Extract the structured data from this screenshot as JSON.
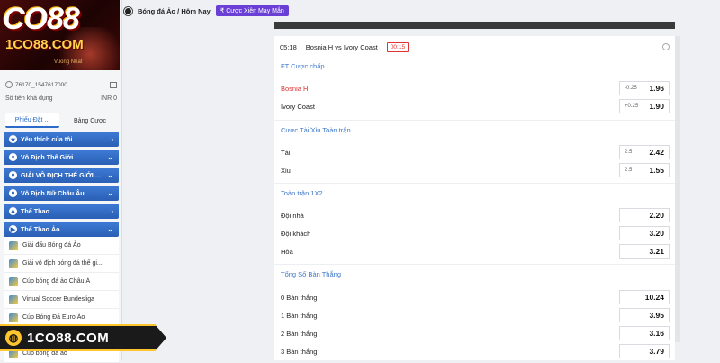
{
  "logo": {
    "brand": "CO88",
    "domain": "1CO88.COM",
    "sub": "Vuong Nhat"
  },
  "account": {
    "id": "76170_1547617000...",
    "balance_label": "Số tiền khả dụng",
    "balance_value": "INR 0"
  },
  "tabs": [
    {
      "label": "Phiếu Đặt ..."
    },
    {
      "label": "Bảng Cược"
    }
  ],
  "menu": [
    {
      "label": "Yêu thích của tôi",
      "icon": "star-icon",
      "chev": "›"
    },
    {
      "label": "Vô Địch Thế Giới",
      "icon": "trophy-icon",
      "chev": "⌄"
    },
    {
      "label": "GIẢI VÔ ĐỊCH THẾ GIỚI ...",
      "icon": "football-icon",
      "chev": "⌄"
    },
    {
      "label": "Vô Địch Nữ Châu Âu",
      "icon": "football-icon",
      "chev": "⌄"
    },
    {
      "label": "Thể Thao",
      "icon": "sports-icon",
      "chev": "›"
    },
    {
      "label": "Thể Thao Ảo",
      "icon": "virtual-sports-icon",
      "chev": "⌄"
    }
  ],
  "submenu": [
    "Giải đấu Bóng đá Ảo",
    "Giải vô địch bóng đá thế gi...",
    "Cúp bóng đá ảo Châu Á",
    "Virtual Soccer Bundesliga",
    "Cúp Bóng Đá Euro Ảo",
    "",
    "Cúp bóng đá ảo"
  ],
  "banner": {
    "text": "1CO88.COM"
  },
  "topbar": {
    "path": "Bóng đá Ảo / Hôm Nay",
    "pill": "₹ Cược Xiên May Mắn"
  },
  "match": {
    "time": "05:18",
    "teams": "Bosnia H vs Ivory Coast",
    "timer": "00:15"
  },
  "sections": {
    "ft": "FT Cược chấp",
    "ou": "Cược Tài/Xỉu Toàn trận",
    "x12": "Toàn trận 1X2",
    "goals": "Tổng Số Bàn Thắng"
  },
  "ft_rows": [
    {
      "name": "Bosnia H",
      "hc": "-0.25",
      "odd": "1.96"
    },
    {
      "name": "Ivory Coast",
      "hc": "+0.25",
      "odd": "1.90"
    }
  ],
  "ou_rows": [
    {
      "name": "Tài",
      "hc": "2.5",
      "odd": "2.42"
    },
    {
      "name": "Xỉu",
      "hc": "2.5",
      "odd": "1.55"
    }
  ],
  "x12_rows": [
    {
      "name": "Đội nhà",
      "odd": "2.20"
    },
    {
      "name": "Đội khách",
      "odd": "3.20"
    },
    {
      "name": "Hòa",
      "odd": "3.21"
    }
  ],
  "goal_rows": [
    {
      "name": "0 Bàn thắng",
      "odd": "10.24"
    },
    {
      "name": "1 Bàn thắng",
      "odd": "3.95"
    },
    {
      "name": "2 Bàn thắng",
      "odd": "3.16"
    },
    {
      "name": "3 Bàn thắng",
      "odd": "3.79"
    }
  ],
  "colors": {
    "accent": "#2a5fb4",
    "link": "#3a76c9",
    "alert": "#dd3333",
    "pill": "#6a3fd6",
    "banner_gold": "#ffc52e"
  }
}
